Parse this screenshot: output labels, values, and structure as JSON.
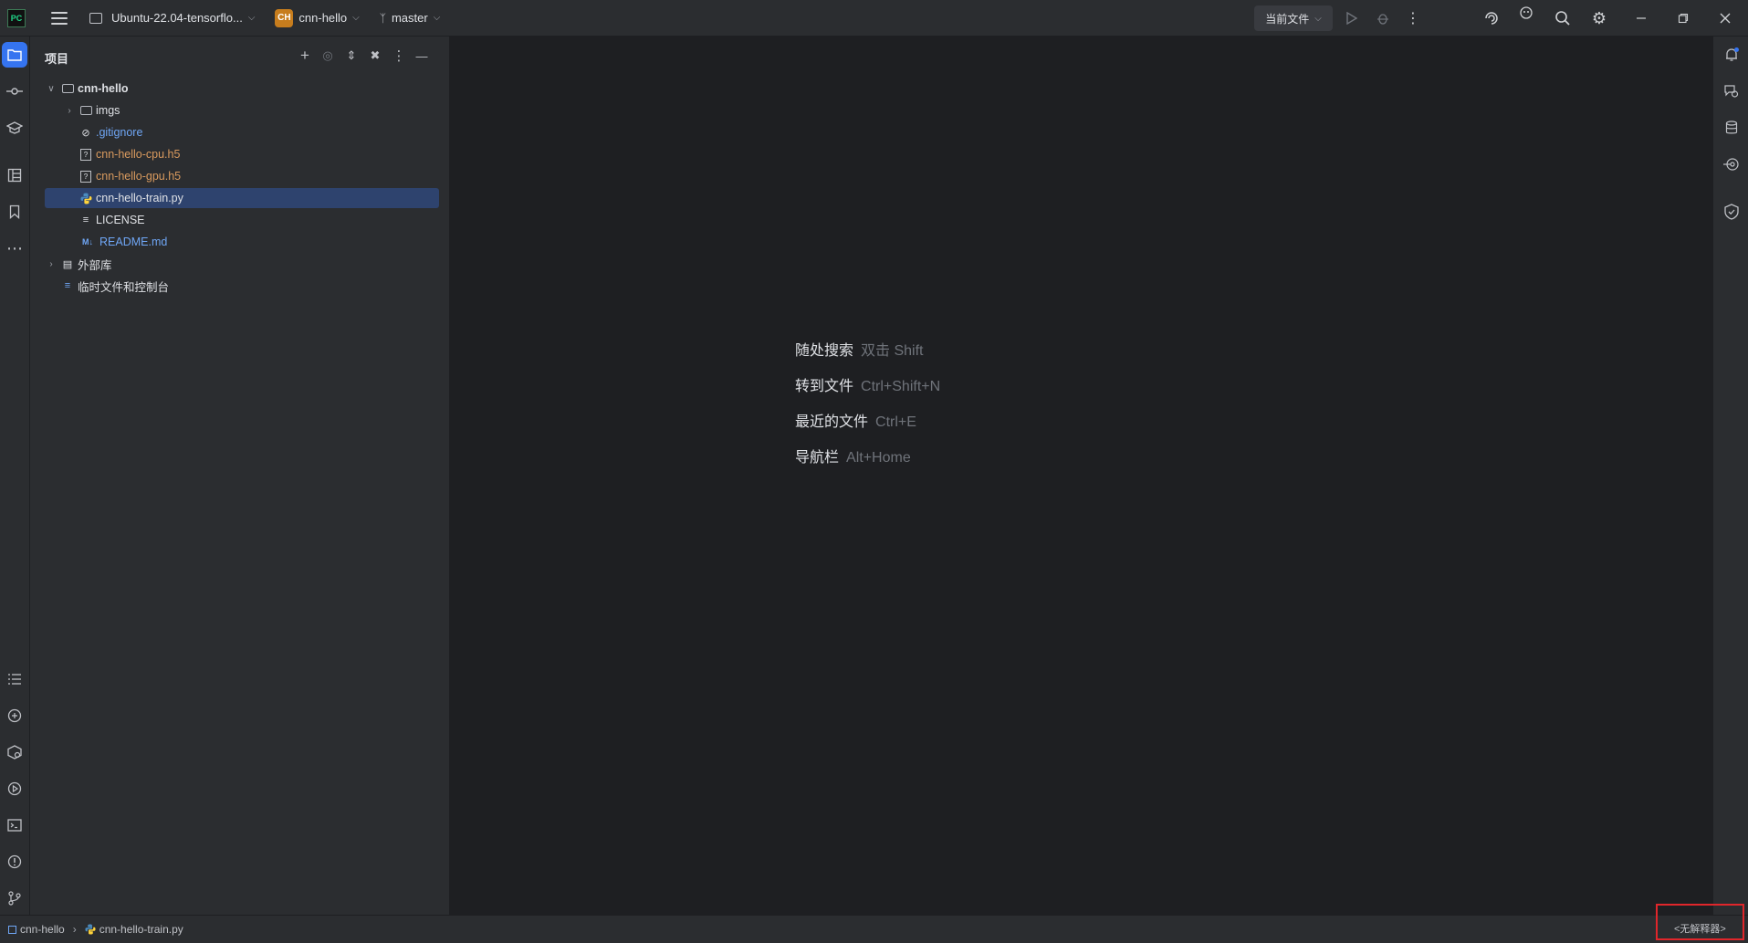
{
  "titlebar": {
    "vm_name": "Ubuntu-22.04-tensorflo...",
    "project_badge": "CH",
    "project_name": "cnn-hello",
    "branch": "master",
    "run_config": "当前文件"
  },
  "project_panel": {
    "title": "项目",
    "tree": [
      {
        "label": "cnn-hello",
        "type": "folder",
        "expanded": true,
        "depth": 0
      },
      {
        "label": "imgs",
        "type": "folder",
        "expanded": false,
        "depth": 1
      },
      {
        "label": ".gitignore",
        "type": "ignore-file",
        "depth": 1
      },
      {
        "label": "cnn-hello-cpu.h5",
        "type": "unknown-file",
        "depth": 1
      },
      {
        "label": "cnn-hello-gpu.h5",
        "type": "unknown-file",
        "depth": 1
      },
      {
        "label": "cnn-hello-train.py",
        "type": "python-file",
        "depth": 1,
        "selected": true
      },
      {
        "label": "LICENSE",
        "type": "text-file",
        "depth": 1
      },
      {
        "label": "README.md",
        "type": "markdown-file",
        "depth": 1
      },
      {
        "label": "外部库",
        "type": "library",
        "expanded": false,
        "depth": 0
      },
      {
        "label": "临时文件和控制台",
        "type": "scratches",
        "depth": 0
      }
    ]
  },
  "editor_hints": [
    {
      "action": "随处搜索",
      "shortcut": "双击 Shift"
    },
    {
      "action": "转到文件",
      "shortcut": "Ctrl+Shift+N"
    },
    {
      "action": "最近的文件",
      "shortcut": "Ctrl+E"
    },
    {
      "action": "导航栏",
      "shortcut": "Alt+Home"
    }
  ],
  "statusbar": {
    "breadcrumb_project": "cnn-hello",
    "breadcrumb_file": "cnn-hello-train.py",
    "interpreter": "<无解释器>"
  },
  "colors": {
    "accent": "#3574f0",
    "selection": "#2e436e",
    "highlight_box": "#e0262b",
    "project_badge": "#c77d1d"
  }
}
